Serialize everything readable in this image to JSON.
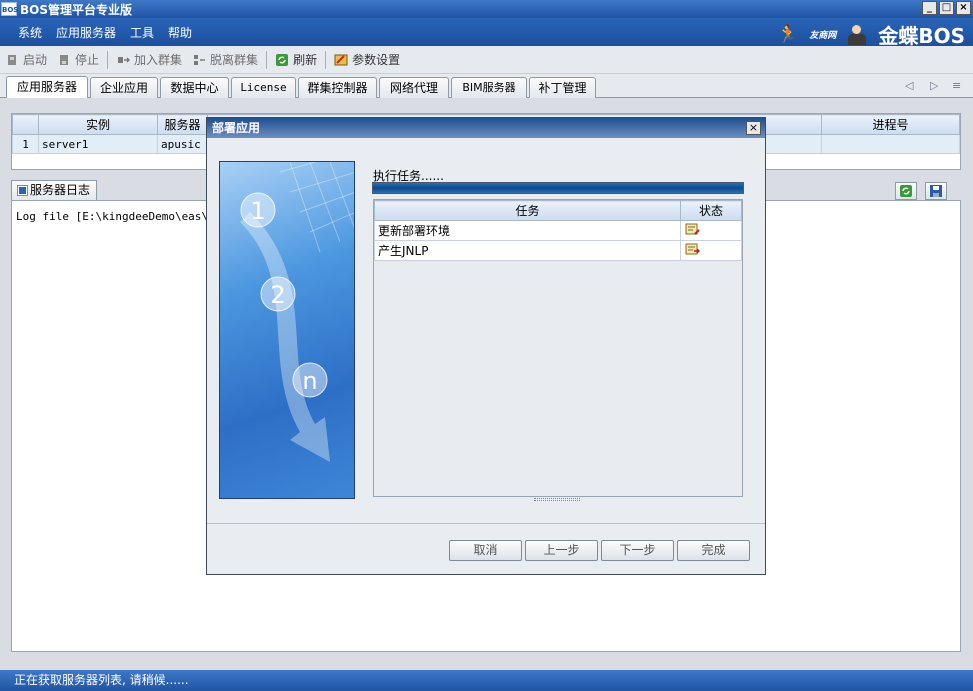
{
  "window": {
    "logo": "BOS",
    "title": "BOS管理平台专业版",
    "controls": [
      "_",
      "□",
      "×"
    ]
  },
  "menu": {
    "items": [
      "系统",
      "应用服务器",
      "工具",
      "帮助"
    ],
    "brand_small": "友商网",
    "brand_big": "金蝶BOS"
  },
  "toolbar": {
    "start": "启动",
    "stop": "停止",
    "join_cluster": "加入群集",
    "leave_cluster": "脱离群集",
    "refresh": "刷新",
    "settings": "参数设置"
  },
  "tabs": [
    "应用服务器",
    "企业应用",
    "数据中心",
    "License",
    "群集控制器",
    "网络代理",
    "BIM服务器",
    "补丁管理"
  ],
  "server_table": {
    "headers": [
      "实例",
      "服务器",
      "进程号"
    ],
    "row": {
      "index": "1",
      "instance": "server1",
      "server": "apusic"
    }
  },
  "log": {
    "tab_label": "服务器日志",
    "text": "Log file [E:\\kingdeeDemo\\eas\\ser"
  },
  "status": "正在获取服务器列表, 请稍候......",
  "dialog": {
    "title": "部署应用",
    "close": "×",
    "step_text": "执行任务......",
    "steps": [
      "1",
      "2",
      "n"
    ],
    "task_headers": [
      "任务",
      "状态"
    ],
    "tasks": [
      "更新部署环境",
      "产生JNLP"
    ],
    "buttons": {
      "cancel": "取消",
      "prev": "上一步",
      "next": "下一步",
      "finish": "完成"
    }
  }
}
